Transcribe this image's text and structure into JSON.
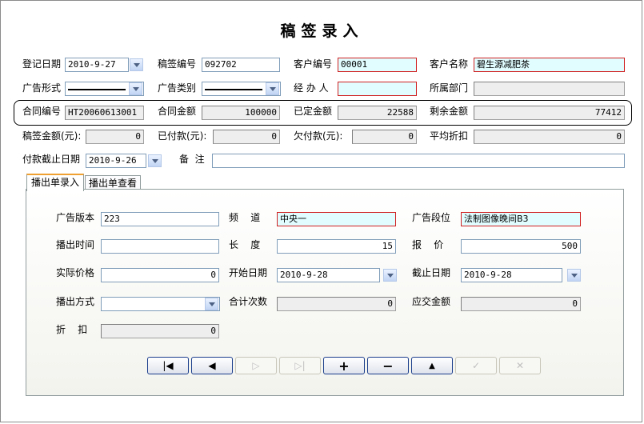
{
  "form": {
    "title": "稿签录入",
    "row1": {
      "reg_date_label": "登记日期",
      "reg_date": "2010-9-27",
      "draft_no_label": "稿签编号",
      "draft_no": "092702",
      "customer_no_label": "客户编号",
      "customer_no": "00001",
      "customer_name_label": "客户名称",
      "customer_name": "碧生源减肥茶"
    },
    "row2": {
      "ad_form_label": "广告形式",
      "ad_form": "",
      "ad_type_label": "广告类别",
      "ad_type": "",
      "handler_label": "经 办 人",
      "handler": "",
      "dept_label": "所属部门",
      "dept": ""
    },
    "row3": {
      "contract_no_label": "合同编号",
      "contract_no": "HT20060613001",
      "contract_amount_label": "合同金额",
      "contract_amount": "100000",
      "fixed_amount_label": "已定金额",
      "fixed_amount": "22588",
      "remaining_label": "剩余金额",
      "remaining": "77412"
    },
    "row4": {
      "draft_amount_label": "稿签金额(元):",
      "draft_amount": "0",
      "paid_label": "已付款(元):",
      "paid": "0",
      "owed_label": "欠付款(元):",
      "owed": "0",
      "avg_discount_label": "平均折扣",
      "avg_discount": "0"
    },
    "row5": {
      "deadline_label": "付款截止日期",
      "deadline": "2010-9-26",
      "remark_label": "备  注",
      "remark": ""
    }
  },
  "tabs": [
    {
      "label": "播出单录入",
      "active": true
    },
    {
      "label": "播出单查看",
      "active": false
    }
  ],
  "broadcast": {
    "version_label": "广告版本",
    "version": "223",
    "channel_label": "频    道",
    "channel": "中央一",
    "segment_label": "广告段位",
    "segment": "法制图像晚间B3",
    "time_label": "播出时间",
    "time": "",
    "length_label": "长    度",
    "length": "15",
    "quote_label": "报    价",
    "quote": "500",
    "actual_price_label": "实际价格",
    "actual_price": "0",
    "start_date_label": "开始日期",
    "start_date": "2010-9-28",
    "end_date_label": "截止日期",
    "end_date": "2010-9-28",
    "method_label": "播出方式",
    "method": "",
    "total_times_label": "合计次数",
    "total_times": "0",
    "due_amount_label": "应交金额",
    "due_amount": "0",
    "discount_label": "折    扣",
    "discount": "0"
  },
  "nav": [
    {
      "name": "first-record-button",
      "icon": "first-icon",
      "glyph": "|◀",
      "enabled": true
    },
    {
      "name": "prev-record-button",
      "icon": "prev-icon",
      "glyph": "◀",
      "enabled": true
    },
    {
      "name": "next-record-button",
      "icon": "next-icon",
      "glyph": "▷",
      "enabled": false
    },
    {
      "name": "last-record-button",
      "icon": "last-icon",
      "glyph": "▷|",
      "enabled": false
    },
    {
      "name": "add-record-button",
      "icon": "plus-icon",
      "glyph": "+",
      "enabled": true
    },
    {
      "name": "delete-record-button",
      "icon": "minus-icon",
      "glyph": "−",
      "enabled": true
    },
    {
      "name": "edit-record-button",
      "icon": "up-triangle-icon",
      "glyph": "▲",
      "enabled": true
    },
    {
      "name": "save-record-button",
      "icon": "check-icon",
      "glyph": "✓",
      "enabled": false
    },
    {
      "name": "cancel-record-button",
      "icon": "x-icon",
      "glyph": "✕",
      "enabled": false
    }
  ]
}
